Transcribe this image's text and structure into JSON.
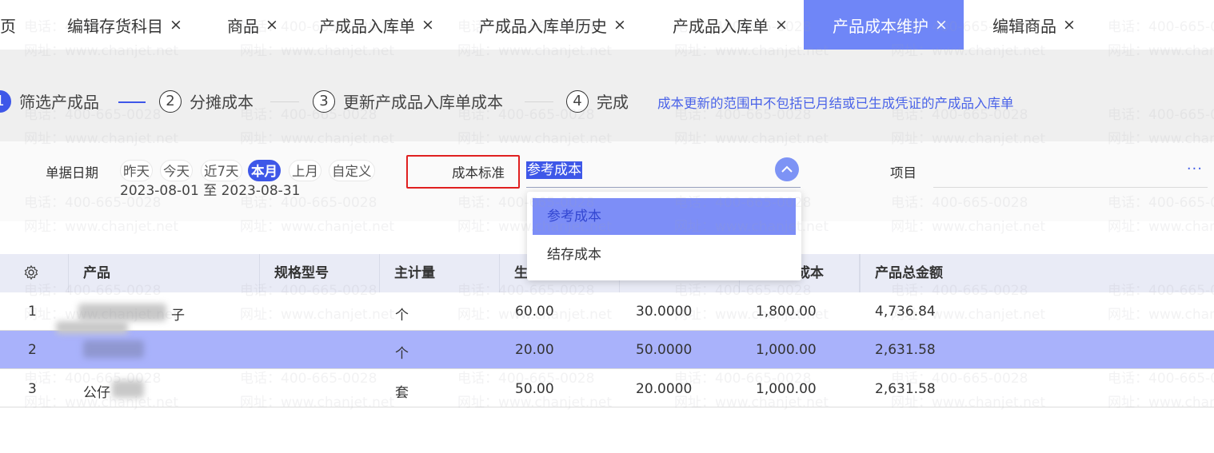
{
  "tabs": [
    {
      "label": "页",
      "closable": false,
      "active": false
    },
    {
      "label": "编辑存货科目",
      "closable": true,
      "active": false
    },
    {
      "label": "商品",
      "closable": true,
      "active": false
    },
    {
      "label": "产成品入库单",
      "closable": true,
      "active": false
    },
    {
      "label": "产成品入库单历史",
      "closable": true,
      "active": false
    },
    {
      "label": "产成品入库单",
      "closable": true,
      "active": false
    },
    {
      "label": "产品成本维护",
      "closable": true,
      "active": true
    },
    {
      "label": "编辑商品",
      "closable": true,
      "active": false
    }
  ],
  "close_glyph": "×",
  "steps": [
    {
      "number": "1",
      "label": "筛选产成品",
      "active": true
    },
    {
      "number": "2",
      "label": "分摊成本",
      "active": false
    },
    {
      "number": "3",
      "label": "更新产成品入库单成本",
      "active": false
    },
    {
      "number": "4",
      "label": "完成",
      "active": false
    }
  ],
  "notice": "成本更新的范围中不包括已月结或已生成凭证的产成品入库单",
  "filters": {
    "date_label": "单据日期",
    "date_chips": [
      {
        "label": "昨天",
        "active": false
      },
      {
        "label": "今天",
        "active": false
      },
      {
        "label": "近7天",
        "active": false
      },
      {
        "label": "本月",
        "active": true
      },
      {
        "label": "上月",
        "active": false
      },
      {
        "label": "自定义",
        "active": false
      }
    ],
    "date_range": "2023-08-01 至 2023-08-31",
    "cost_standard_label": "成本标准",
    "cost_standard_value": "参考成本",
    "project_label": "项目",
    "more_glyph": "···"
  },
  "dropdown": {
    "options": [
      {
        "label": "参考成本",
        "selected": true
      },
      {
        "label": "结存成本",
        "selected": false
      }
    ]
  },
  "table": {
    "columns": [
      "产品",
      "规格型号",
      "主计量",
      "生",
      "成本",
      "产品总金额"
    ],
    "rows": [
      {
        "index": "1",
        "product": "子",
        "spec": "",
        "unit": "个",
        "qty": "60.00",
        "unit_cost": "30.0000",
        "cost": "1,800.00",
        "total": "4,736.84",
        "selected": false
      },
      {
        "index": "2",
        "product": "",
        "spec": "",
        "unit": "个",
        "qty": "20.00",
        "unit_cost": "50.0000",
        "cost": "1,000.00",
        "total": "2,631.58",
        "selected": true
      },
      {
        "index": "3",
        "product": "公仔",
        "spec": "",
        "unit": "套",
        "qty": "50.00",
        "unit_cost": "20.0000",
        "cost": "1,000.00",
        "total": "2,631.58",
        "selected": false
      }
    ]
  },
  "watermark": {
    "phone": "电话：400-665-0028",
    "site": "网址：www.chanjet.net"
  },
  "colors": {
    "accent": "#3e57e8",
    "active_tab": "#6f86f7",
    "selected_row": "#a9b2fb",
    "highlight_box": "#e02020"
  }
}
